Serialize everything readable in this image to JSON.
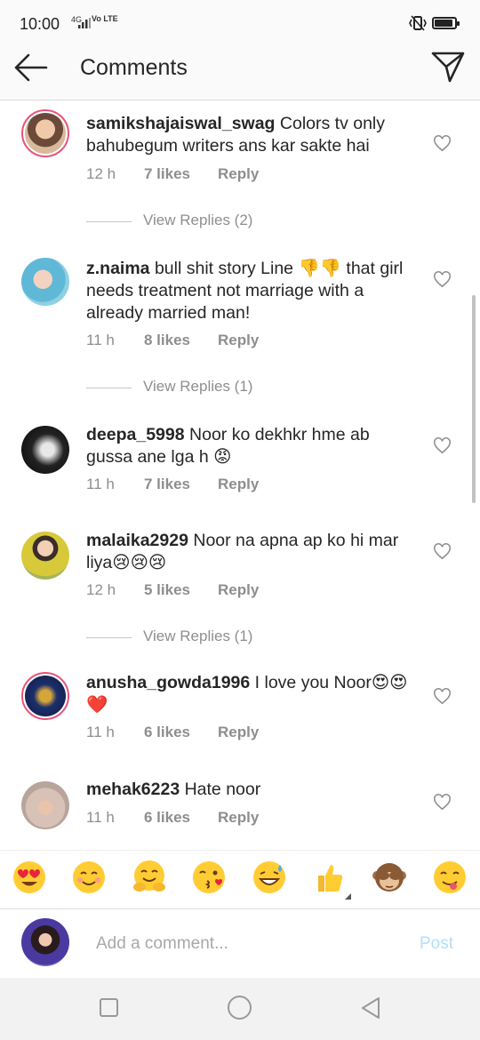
{
  "status_bar": {
    "time": "10:00",
    "network": "4G",
    "volte": "Vo LTE"
  },
  "header": {
    "title": "Comments",
    "back_icon": "arrow-left-icon",
    "send_icon": "paper-plane-icon"
  },
  "comments": [
    {
      "username": "samikshajaiswal_swag",
      "text": " Colors tv  only bahubegum writers ans kar sakte hai",
      "time": "12 h",
      "likes": "7 likes",
      "reply": "Reply",
      "view_replies": "View Replies (2)"
    },
    {
      "username": "z.naima",
      "text": " bull shit  story  Line 👎👎 that girl needs treatment  not marriage  with a already married man!",
      "time": "11 h",
      "likes": "8 likes",
      "reply": "Reply",
      "view_replies": "View Replies (1)"
    },
    {
      "username": "deepa_5998",
      "text": " Noor ko dekhkr hme ab gussa ane lga h 😡",
      "time": "11 h",
      "likes": "7 likes",
      "reply": "Reply"
    },
    {
      "username": "malaika2929",
      "text": " Noor na apna ap ko hi mar liya😢😢😢",
      "time": "12 h",
      "likes": "5 likes",
      "reply": "Reply",
      "view_replies": "View Replies (1)"
    },
    {
      "username": "anusha_gowda1996",
      "text": " I love you Noor😍😍❤️",
      "time": "11 h",
      "likes": "6 likes",
      "reply": "Reply"
    },
    {
      "username": "mehak6223",
      "text": " Hate noor",
      "time": "11 h",
      "likes": "6 likes",
      "reply": "Reply"
    }
  ],
  "emoji_bar": [
    "😍",
    "😊",
    "🤗",
    "😘",
    "😅",
    "👍",
    "🙈",
    "😋"
  ],
  "input": {
    "placeholder": "Add a comment...",
    "post_label": "Post"
  },
  "colors": {
    "link_disabled": "#b2dffc",
    "meta": "#8e8e8e",
    "story_ring": "#e8547a"
  }
}
